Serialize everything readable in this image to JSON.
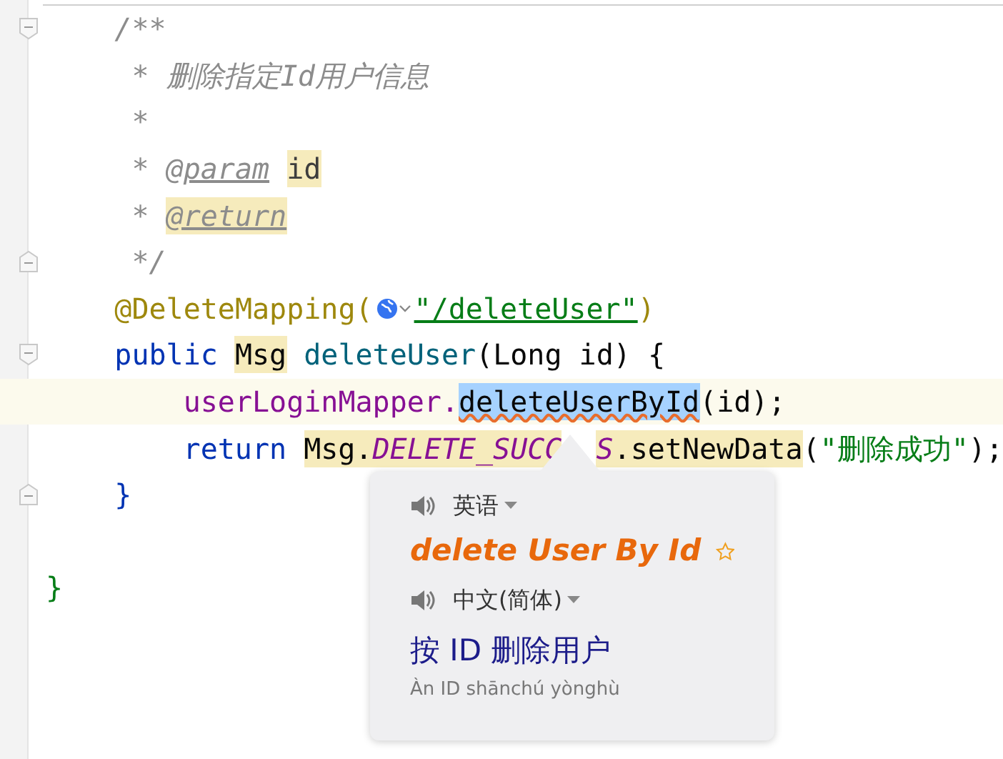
{
  "code_lines": [
    {
      "current": false,
      "fold_start": true,
      "tokens": [
        {
          "text": "    /**",
          "kind": "comment"
        }
      ]
    },
    {
      "current": false,
      "tokens": [
        {
          "text": "     * 删除指定Id用户信息",
          "kind": "comment"
        }
      ]
    },
    {
      "current": false,
      "tokens": [
        {
          "text": "     *",
          "kind": "comment"
        }
      ]
    },
    {
      "current": false,
      "tokens": [
        {
          "text": "     *",
          "kind": "comment"
        },
        {
          "text": "@param",
          "kind": "doctag",
          "spaced": true,
          "underlined": true
        },
        {
          "text": "id",
          "kind": "docparam",
          "spaced": true,
          "highlighted": true
        }
      ]
    },
    {
      "current": false,
      "tokens": [
        {
          "text": "     *",
          "kind": "comment"
        },
        {
          "text": "@return",
          "kind": "doctag",
          "spaced": true,
          "underlined": true,
          "highlighted": true
        }
      ]
    },
    {
      "current": false,
      "fold_end": true,
      "tokens": [
        {
          "text": "     */",
          "kind": "comment"
        }
      ]
    },
    {
      "current": false,
      "tokens": [
        {
          "text": "    @DeleteMapping(",
          "kind": "annotation"
        },
        {
          "kind": "url-hint"
        },
        {
          "text": "\"/deleteUser\"",
          "kind": "string",
          "underlined": true
        },
        {
          "text": ")",
          "kind": "annotation"
        }
      ]
    },
    {
      "current": false,
      "fold_start": true,
      "tokens": [
        {
          "text": "    public",
          "kind": "keyword"
        },
        {
          "text": "Msg",
          "kind": "plain",
          "spaced": true,
          "highlighted": true
        },
        {
          "text": "deleteUser",
          "kind": "method",
          "spaced": true
        },
        {
          "text": "(Long id) {",
          "kind": "plain"
        }
      ]
    },
    {
      "current": true,
      "tokens": [
        {
          "text": "        userLoginMapper.",
          "kind": "field"
        },
        {
          "text": "deleteUserById",
          "kind": "plain",
          "selected": true,
          "error": true
        },
        {
          "text": "(id);",
          "kind": "plain"
        }
      ]
    },
    {
      "current": false,
      "tokens": [
        {
          "text": "        return",
          "kind": "keyword"
        },
        {
          "text": "Msg.",
          "kind": "plain",
          "spaced": true,
          "highlighted": true
        },
        {
          "text": "DELETE_SUCC",
          "kind": "constant",
          "highlighted": true
        },
        {
          "kind": "covered"
        },
        {
          "text": "S",
          "kind": "constant",
          "highlighted": true
        },
        {
          "text": ".setNewData",
          "kind": "plain",
          "highlighted": true
        },
        {
          "text": "(",
          "kind": "plain"
        },
        {
          "text": "\"删除成功\"",
          "kind": "string"
        },
        {
          "text": ");",
          "kind": "plain"
        }
      ]
    },
    {
      "current": false,
      "fold_end": true,
      "tokens": [
        {
          "text": "    }",
          "kind": "keyword"
        }
      ]
    },
    {
      "current": false
    },
    {
      "current": false,
      "tokens": [
        {
          "text": "}",
          "kind": "string"
        }
      ]
    }
  ],
  "translation_popup": {
    "source_language": "英语",
    "source_text": "delete User By Id",
    "favorite": false,
    "target_language": "中文(简体)",
    "translation": "按 ID 删除用户",
    "pinyin": "Àn ID shānchú yònghù"
  }
}
